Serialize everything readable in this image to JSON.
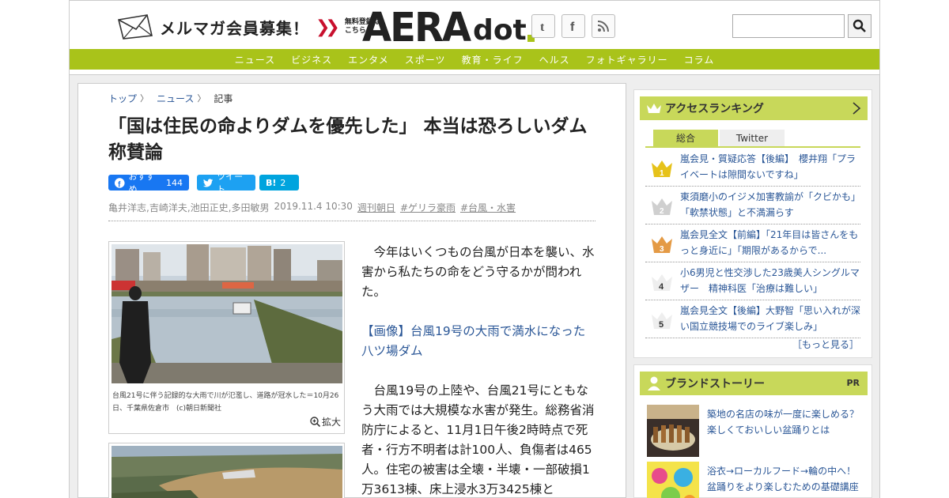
{
  "header": {
    "mailmag_label": "メルマガ会員募集！",
    "mailmag_sub_1": "無料登録は",
    "mailmag_sub_2": "こちら",
    "logo_main": "AERA",
    "logo_sub": "dot"
  },
  "nav": {
    "items": [
      "ニュース",
      "ビジネス",
      "エンタメ",
      "スポーツ",
      "教育・ライフ",
      "ヘルス",
      "フォトギャラリー",
      "コラム"
    ]
  },
  "breadcrumb": {
    "top": "トップ",
    "news": "ニュース",
    "current": "記事"
  },
  "article": {
    "title": "「国は住民の命よりダムを優先した」 本当は恐ろしいダム称賛論",
    "share_fb": "おすすめ",
    "share_fb_count": "144",
    "share_tw": "ツイート",
    "share_hb": "B!",
    "share_hb_count": "2",
    "authors": "亀井洋志,吉崎洋夫,池田正史,多田敏男",
    "date": "2019.11.4 10:30",
    "source": "週刊朝日",
    "tag1": "#ゲリラ豪雨",
    "tag2": "#台風・水害",
    "photo_caption": "台風21号に伴う記録的な大雨で川が氾濫し、道路が冠水した＝10月26日、千葉県佐倉市　(c)朝日新聞社",
    "expand_label": "拡大",
    "para1": "今年はいくつもの台風が日本を襲い、水害から私たちの命をどう守るかが問われた。",
    "link_text": "【画像】台風19号の大雨で満水になった八ツ場ダム",
    "para2": "台風19号の上陸や、台風21号にともなう大雨では大規模な水害が発生。総務省消防庁によると、11月1日午後2時時点で死者・行方不明者は計100人、負傷者は465人。住宅の被害は全壊・半壊・一部破損1万3613棟、床上浸水3万3425棟と"
  },
  "ranking": {
    "title": "アクセスランキング",
    "tab_all": "総合",
    "tab_twitter": "Twitter",
    "items": [
      {
        "rank": "1",
        "text": "嵐会見・質疑応答【後編】　櫻井翔「プライベートは隙間ないですね」"
      },
      {
        "rank": "2",
        "text": "東須磨小のイジメ加害教諭が「クビかも」「軟禁状態」と不満漏らす"
      },
      {
        "rank": "3",
        "text": "嵐会見全文【前編】「21年目は皆さんをもっと身近に」「期限があるからで..."
      },
      {
        "rank": "4",
        "text": "小6男児と性交渉した23歳美人シングルマザー　精神科医「治療は難しい」"
      },
      {
        "rank": "5",
        "text": "嵐会見全文【後編】大野智「思い入れが深い国立競技場でのライブ楽しみ」"
      }
    ],
    "more": "［もっと見る］"
  },
  "brand": {
    "title": "ブランドストーリー",
    "pr": "PR",
    "items": [
      {
        "text": "築地の名店の味が一度に楽しめる？楽しくておいしい盆踊りとは"
      },
      {
        "text": "浴衣→ローカルフード→輪の中へ！盆踊りをより楽しむための基礎講座"
      }
    ]
  },
  "colors": {
    "accent": "#a9c31a",
    "sidebar_head": "#c8d85a",
    "link": "#2b5797",
    "facebook": "#1877f2",
    "twitter": "#1da1f2",
    "hatena": "#00a4de"
  }
}
